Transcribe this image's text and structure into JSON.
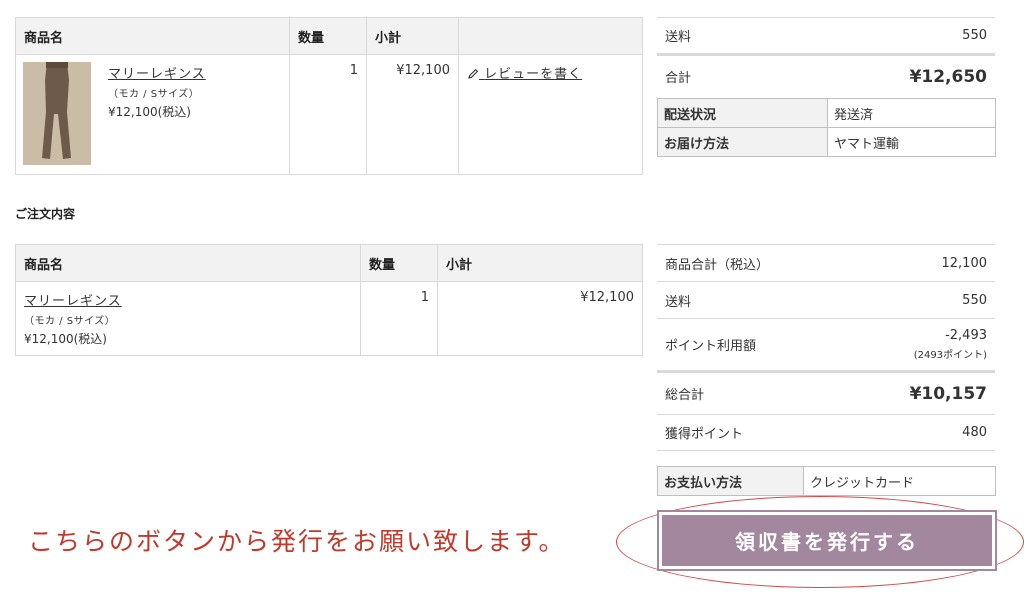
{
  "review_table": {
    "headers": {
      "product": "商品名",
      "qty": "数量",
      "subtotal": "小計"
    },
    "item": {
      "name": "マリーレギンス",
      "variant": "（モカ / Sサイズ）",
      "price": "¥12,100(税込)",
      "qty": "1",
      "subtotal": "¥12,100",
      "review_link": "レビューを書く"
    }
  },
  "top_summary": {
    "shipping_label": "送料",
    "shipping_value": "550",
    "total_label": "合計",
    "total_value": "¥12,650"
  },
  "delivery": {
    "status_label": "配送状況",
    "status_value": "発送済",
    "method_label": "お届け方法",
    "method_value": "ヤマト運輸"
  },
  "order_section": {
    "title": "ご注文内容",
    "headers": {
      "product": "商品名",
      "qty": "数量",
      "subtotal": "小計"
    },
    "item": {
      "name": "マリーレギンス",
      "variant": "（モカ / Sサイズ）",
      "price": "¥12,100(税込)",
      "qty": "1",
      "subtotal": "¥12,100"
    }
  },
  "order_summary": {
    "items_total_label": "商品合計（税込）",
    "items_total_value": "12,100",
    "shipping_label": "送料",
    "shipping_value": "550",
    "points_used_label": "ポイント利用額",
    "points_used_value": "-2,493",
    "points_used_note": "(2493ポイント)",
    "grand_total_label": "総合計",
    "grand_total_value": "¥10,157",
    "earned_points_label": "獲得ポイント",
    "earned_points_value": "480"
  },
  "payment": {
    "label": "お支払い方法",
    "value": "クレジットカード"
  },
  "annotation": {
    "note": "こちらのボタンから発行をお願い致します。"
  },
  "receipt_button": {
    "label": "領収書を発行する"
  },
  "colors": {
    "button": "#a3879e",
    "annotation": "#c0392b",
    "header_bg": "#f2f2f2"
  }
}
